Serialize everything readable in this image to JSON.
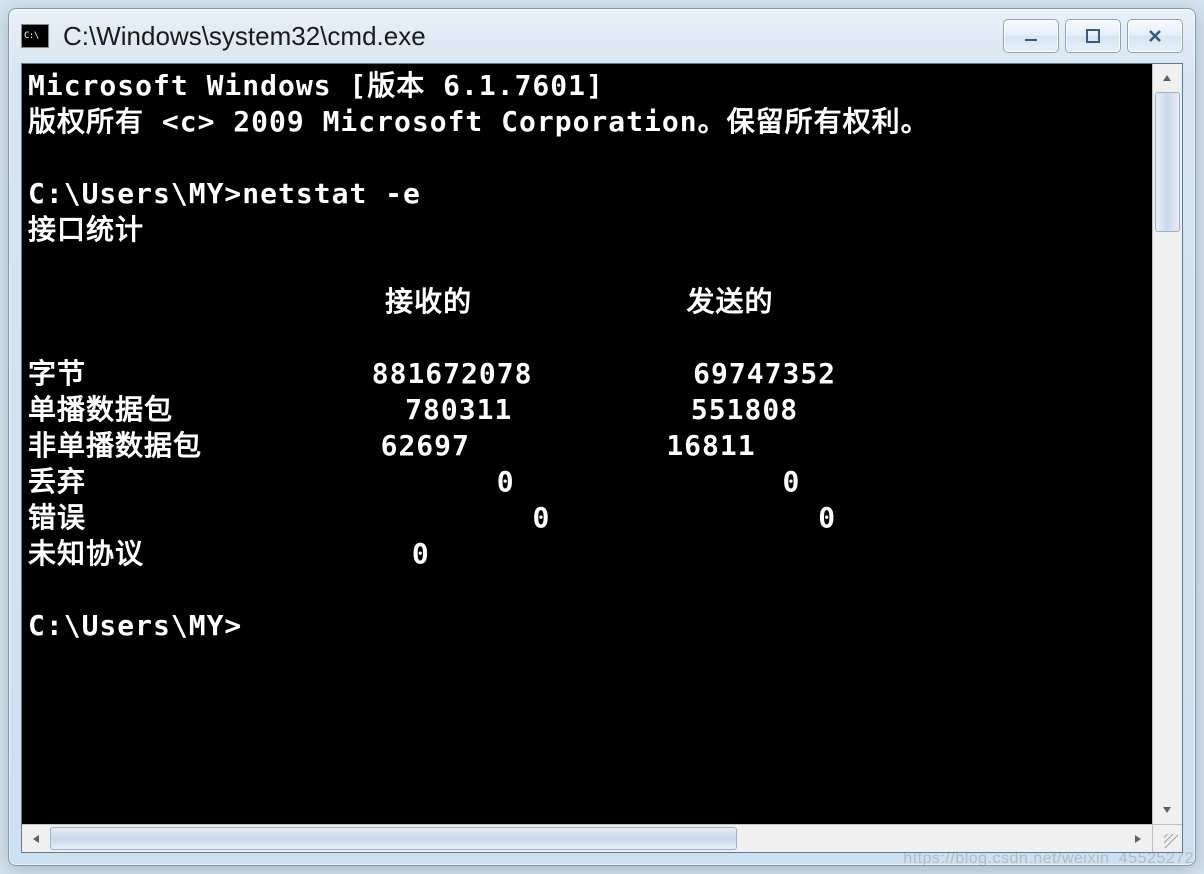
{
  "window": {
    "title": "C:\\Windows\\system32\\cmd.exe"
  },
  "terminal": {
    "line_version": "Microsoft Windows [版本 6.1.7601]",
    "line_copyright": "版权所有 <c> 2009 Microsoft Corporation。保留所有权利。",
    "blank": "",
    "prompt1_prefix": "C:\\Users\\MY>",
    "prompt1_command": "netstat -e",
    "heading_stats": "接口统计",
    "col_header_row": "                    接收的            发送的",
    "rows": {
      "bytes": {
        "label": "字节",
        "recv": "881672078",
        "sent": "69747352"
      },
      "unicast": {
        "label": "单播数据包",
        "recv": "780311",
        "sent": "551808"
      },
      "nonunicast": {
        "label": "非单播数据包",
        "recv": "62697",
        "sent": "16811"
      },
      "discard": {
        "label": "丢弃",
        "recv": "0",
        "sent": "0"
      },
      "error": {
        "label": "错误",
        "recv": "0",
        "sent": "0"
      },
      "unknown": {
        "label": "未知协议",
        "recv": "0",
        "sent": ""
      }
    },
    "prompt2": "C:\\Users\\MY>"
  },
  "watermark": "https://blog.csdn.net/weixin_45525272"
}
